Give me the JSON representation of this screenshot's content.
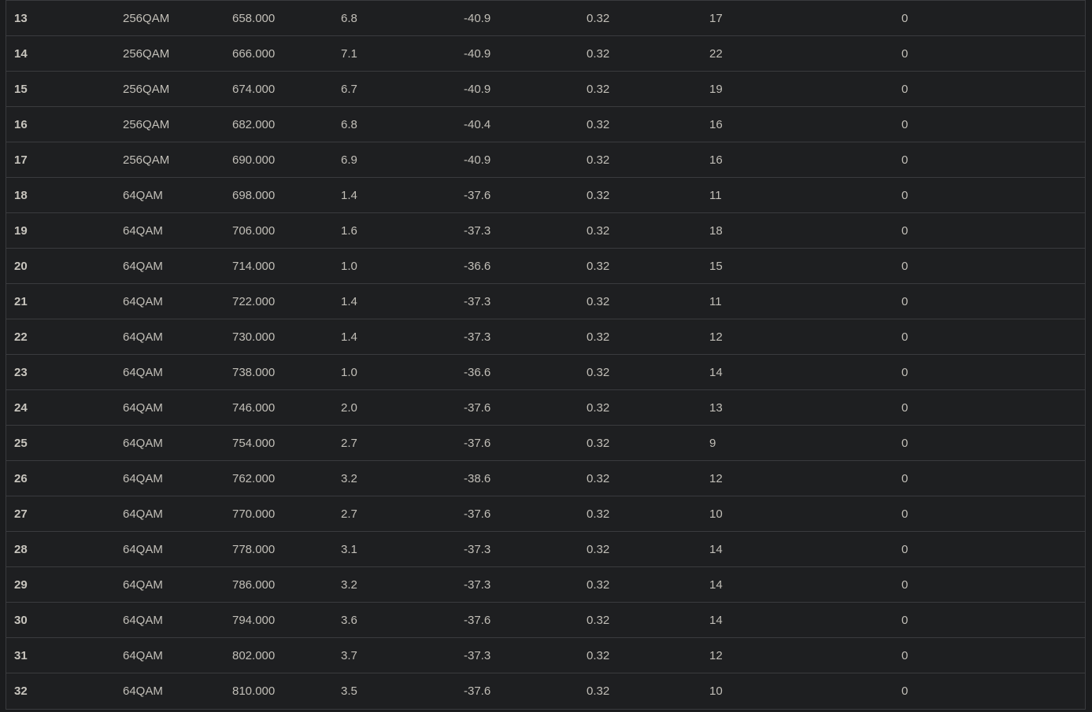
{
  "table": {
    "rows": [
      [
        "13",
        "256QAM",
        "658.000",
        "6.8",
        "-40.9",
        "0.32",
        "17",
        "0"
      ],
      [
        "14",
        "256QAM",
        "666.000",
        "7.1",
        "-40.9",
        "0.32",
        "22",
        "0"
      ],
      [
        "15",
        "256QAM",
        "674.000",
        "6.7",
        "-40.9",
        "0.32",
        "19",
        "0"
      ],
      [
        "16",
        "256QAM",
        "682.000",
        "6.8",
        "-40.4",
        "0.32",
        "16",
        "0"
      ],
      [
        "17",
        "256QAM",
        "690.000",
        "6.9",
        "-40.9",
        "0.32",
        "16",
        "0"
      ],
      [
        "18",
        "64QAM",
        "698.000",
        "1.4",
        "-37.6",
        "0.32",
        "11",
        "0"
      ],
      [
        "19",
        "64QAM",
        "706.000",
        "1.6",
        "-37.3",
        "0.32",
        "18",
        "0"
      ],
      [
        "20",
        "64QAM",
        "714.000",
        "1.0",
        "-36.6",
        "0.32",
        "15",
        "0"
      ],
      [
        "21",
        "64QAM",
        "722.000",
        "1.4",
        "-37.3",
        "0.32",
        "11",
        "0"
      ],
      [
        "22",
        "64QAM",
        "730.000",
        "1.4",
        "-37.3",
        "0.32",
        "12",
        "0"
      ],
      [
        "23",
        "64QAM",
        "738.000",
        "1.0",
        "-36.6",
        "0.32",
        "14",
        "0"
      ],
      [
        "24",
        "64QAM",
        "746.000",
        "2.0",
        "-37.6",
        "0.32",
        "13",
        "0"
      ],
      [
        "25",
        "64QAM",
        "754.000",
        "2.7",
        "-37.6",
        "0.32",
        "9",
        "0"
      ],
      [
        "26",
        "64QAM",
        "762.000",
        "3.2",
        "-38.6",
        "0.32",
        "12",
        "0"
      ],
      [
        "27",
        "64QAM",
        "770.000",
        "2.7",
        "-37.6",
        "0.32",
        "10",
        "0"
      ],
      [
        "28",
        "64QAM",
        "778.000",
        "3.1",
        "-37.3",
        "0.32",
        "14",
        "0"
      ],
      [
        "29",
        "64QAM",
        "786.000",
        "3.2",
        "-37.3",
        "0.32",
        "14",
        "0"
      ],
      [
        "30",
        "64QAM",
        "794.000",
        "3.6",
        "-37.6",
        "0.32",
        "14",
        "0"
      ],
      [
        "31",
        "64QAM",
        "802.000",
        "3.7",
        "-37.3",
        "0.32",
        "12",
        "0"
      ],
      [
        "32",
        "64QAM",
        "810.000",
        "3.5",
        "-37.6",
        "0.32",
        "10",
        "0"
      ]
    ]
  }
}
